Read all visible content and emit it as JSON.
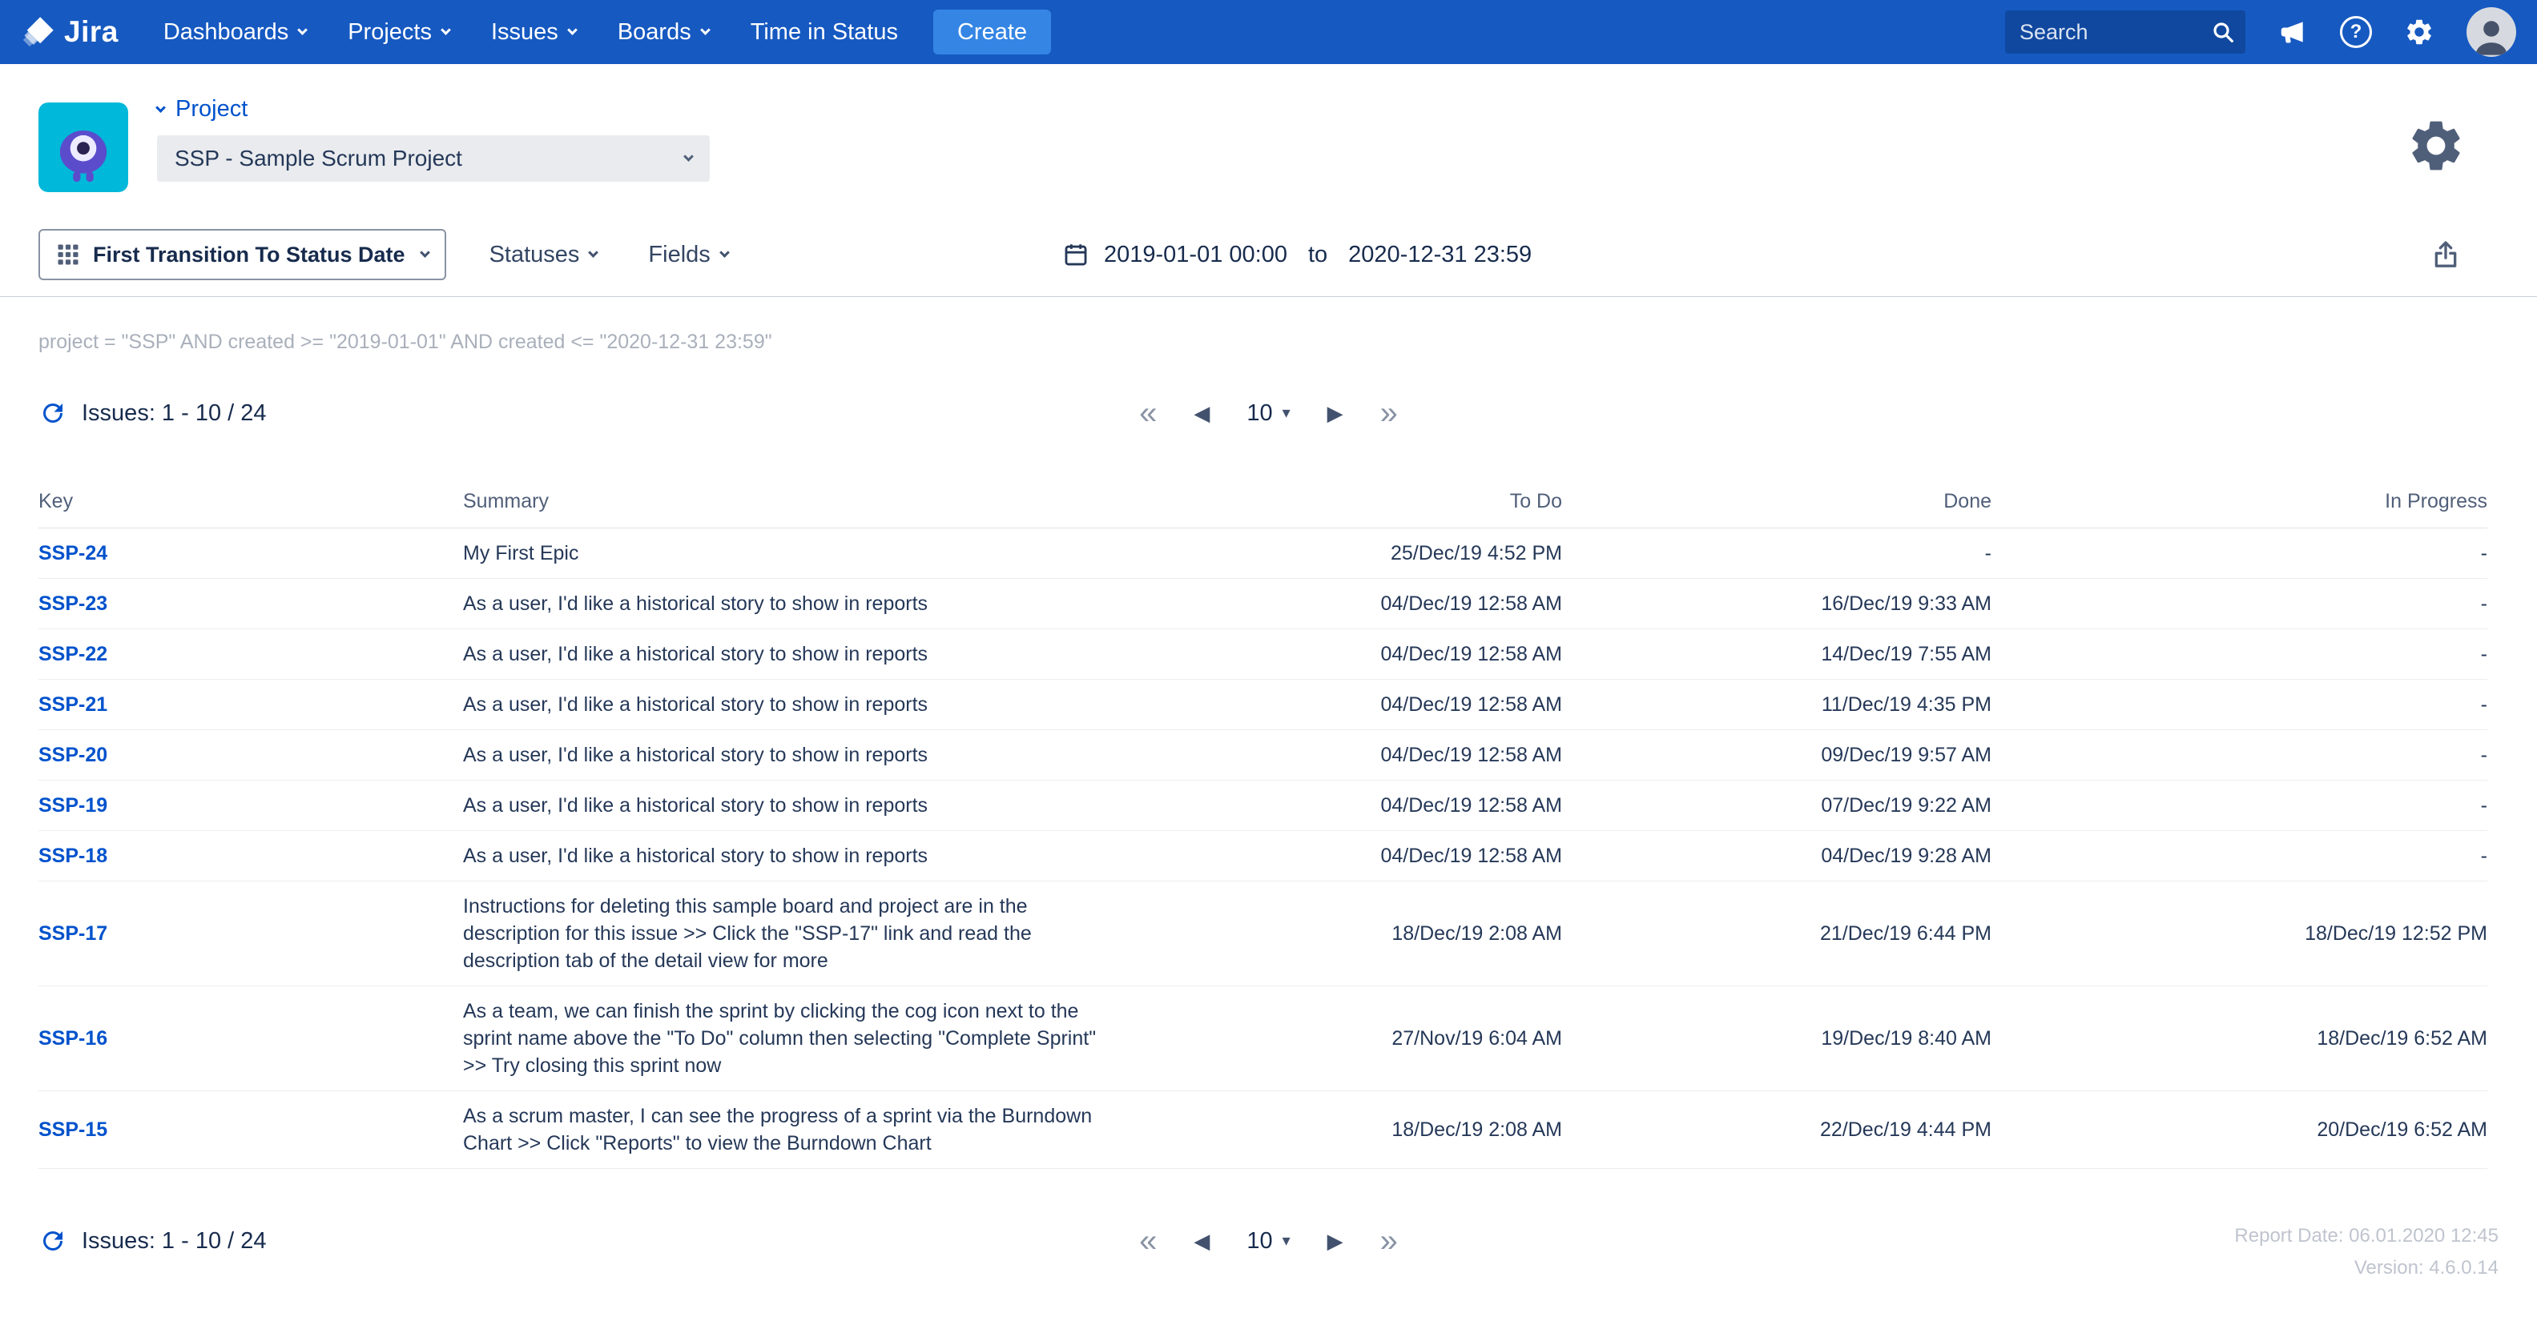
{
  "colors": {
    "navbar_bg": "#1659C1",
    "create_button_bg": "#3485E4",
    "link_blue": "#0052CC",
    "project_avatar_teal": "#00B8D9",
    "project_avatar_purple": "#5B4CCC",
    "text_dark": "#172B4D",
    "jql_gray": "#A9B0BB",
    "footer_gray": "#BFC4CE"
  },
  "navbar": {
    "brand": "Jira",
    "items": [
      {
        "label": "Dashboards"
      },
      {
        "label": "Projects"
      },
      {
        "label": "Issues"
      },
      {
        "label": "Boards"
      },
      {
        "label": "Time in Status"
      }
    ],
    "create_label": "Create",
    "search_placeholder": "Search"
  },
  "project_header": {
    "section_label": "Project",
    "selected_project": "SSP - Sample Scrum Project"
  },
  "toolbar": {
    "report_type_label": "First Transition To Status Date",
    "statuses_label": "Statuses",
    "fields_label": "Fields",
    "date_from": "2019-01-01 00:00",
    "date_separator": "to",
    "date_to": "2020-12-31 23:59"
  },
  "jql_text": "project = \"SSP\" AND created >= \"2019-01-01\" AND created <= \"2020-12-31 23:59\"",
  "issues_summary": "Issues: 1 - 10 / 24",
  "pagination": {
    "first": "«",
    "prev": "◀",
    "page_size": "10",
    "caret": "▾",
    "next": "▶",
    "last": "»"
  },
  "table": {
    "headers": {
      "key": "Key",
      "summary": "Summary",
      "todo": "To Do",
      "done": "Done",
      "in_progress": "In Progress"
    },
    "rows": [
      {
        "key": "SSP-24",
        "summary": "My First Epic",
        "todo": "25/Dec/19 4:52 PM",
        "done": "-",
        "in_progress": "-"
      },
      {
        "key": "SSP-23",
        "summary": "As a user, I'd like a historical story to show in reports",
        "todo": "04/Dec/19 12:58 AM",
        "done": "16/Dec/19 9:33 AM",
        "in_progress": "-"
      },
      {
        "key": "SSP-22",
        "summary": "As a user, I'd like a historical story to show in reports",
        "todo": "04/Dec/19 12:58 AM",
        "done": "14/Dec/19 7:55 AM",
        "in_progress": "-"
      },
      {
        "key": "SSP-21",
        "summary": "As a user, I'd like a historical story to show in reports",
        "todo": "04/Dec/19 12:58 AM",
        "done": "11/Dec/19 4:35 PM",
        "in_progress": "-"
      },
      {
        "key": "SSP-20",
        "summary": "As a user, I'd like a historical story to show in reports",
        "todo": "04/Dec/19 12:58 AM",
        "done": "09/Dec/19 9:57 AM",
        "in_progress": "-"
      },
      {
        "key": "SSP-19",
        "summary": "As a user, I'd like a historical story to show in reports",
        "todo": "04/Dec/19 12:58 AM",
        "done": "07/Dec/19 9:22 AM",
        "in_progress": "-"
      },
      {
        "key": "SSP-18",
        "summary": "As a user, I'd like a historical story to show in reports",
        "todo": "04/Dec/19 12:58 AM",
        "done": "04/Dec/19 9:28 AM",
        "in_progress": "-"
      },
      {
        "key": "SSP-17",
        "summary": "Instructions for deleting this sample board and project are in the description for this issue >> Click the \"SSP-17\" link and read the description tab of the detail view for more",
        "todo": "18/Dec/19 2:08 AM",
        "done": "21/Dec/19 6:44 PM",
        "in_progress": "18/Dec/19 12:52 PM"
      },
      {
        "key": "SSP-16",
        "summary": "As a team, we can finish the sprint by clicking the cog icon next to the sprint name above the \"To Do\" column then selecting \"Complete Sprint\" >> Try closing this sprint now",
        "todo": "27/Nov/19 6:04 AM",
        "done": "19/Dec/19 8:40 AM",
        "in_progress": "18/Dec/19 6:52 AM"
      },
      {
        "key": "SSP-15",
        "summary": "As a scrum master, I can see the progress of a sprint via the Burndown Chart >> Click \"Reports\" to view the Burndown Chart",
        "todo": "18/Dec/19 2:08 AM",
        "done": "22/Dec/19 4:44 PM",
        "in_progress": "20/Dec/19 6:52 AM"
      }
    ]
  },
  "footer": {
    "report_date": "Report Date: 06.01.2020 12:45",
    "version": "Version: 4.6.0.14"
  }
}
